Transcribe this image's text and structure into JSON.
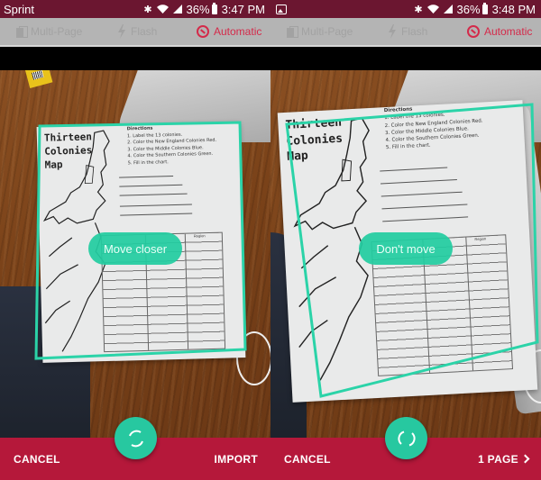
{
  "screens": [
    {
      "status_bar": {
        "carrier": "Sprint",
        "bluetooth_icon": "bluetooth-icon",
        "wifi_icon": "wifi-icon",
        "signal_icon": "cell-signal-icon",
        "battery_percent": "36%",
        "battery_icon": "battery-icon",
        "time": "3:47 PM"
      },
      "toolbar": {
        "multipage_label": "Multi-Page",
        "flash_label": "Flash",
        "capture_mode_label": "Automatic"
      },
      "camera": {
        "document": {
          "title_lines": [
            "Thirteen",
            "Colonies",
            "Map"
          ],
          "directions_heading": "Directions",
          "directions": [
            "1. Label the 13 colonies.",
            "2. Color the New England Colonies Red.",
            "3. Color the Middle Colonies Blue.",
            "4. Color the Southern Colonies Green.",
            "5. Fill in the chart."
          ],
          "table_header_region": "Region"
        },
        "hint": "Move closer"
      },
      "bottom_bar": {
        "cancel_label": "CANCEL",
        "right_label": "IMPORT",
        "shutter_icon": "capture-progress-icon"
      }
    },
    {
      "status_bar": {
        "notification_icon": "gallery-notification-icon",
        "bluetooth_icon": "bluetooth-icon",
        "wifi_icon": "wifi-icon",
        "signal_icon": "cell-signal-icon",
        "battery_percent": "36%",
        "battery_icon": "battery-icon",
        "time": "3:48 PM"
      },
      "toolbar": {
        "multipage_label": "Multi-Page",
        "flash_label": "Flash",
        "capture_mode_label": "Automatic"
      },
      "camera": {
        "document": {
          "title_lines": [
            "Thirteen",
            "Colonies",
            "Map"
          ],
          "directions_heading": "Directions",
          "directions": [
            "1. Label the 13 colonies.",
            "2. Color the New England Colonies Red.",
            "3. Color the Middle Colonies Blue.",
            "4. Color the Southern Colonies Green.",
            "5. Fill in the chart."
          ],
          "table_header_region": "Region"
        },
        "hint": "Don't move"
      },
      "bottom_bar": {
        "cancel_label": "CANCEL",
        "right_label": "1 PAGE",
        "right_icon": "chevron-right-icon",
        "shutter_icon": "capture-progress-icon"
      }
    }
  ],
  "colors": {
    "status_bar": "#6b1630",
    "toolbar": "#b4b4b4",
    "accent_red": "#d42a4a",
    "bottom_bar": "#b5183a",
    "teal": "#27c8a0"
  }
}
